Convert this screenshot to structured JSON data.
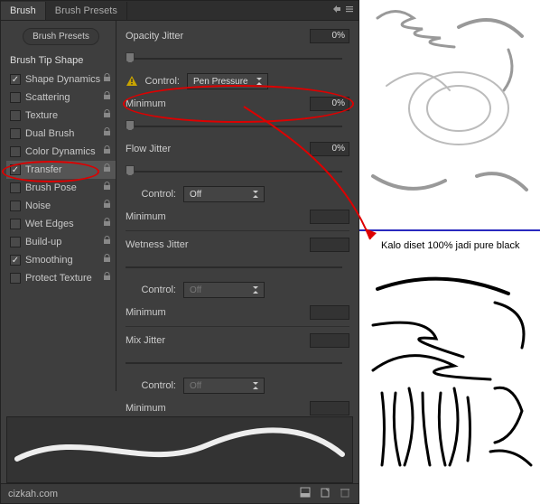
{
  "tabs": {
    "brush": "Brush",
    "presets": "Brush Presets"
  },
  "sidebar": {
    "presets_button": "Brush Presets",
    "tip_shape": "Brush Tip Shape",
    "items": [
      {
        "label": "Shape Dynamics",
        "checked": true,
        "locked": true
      },
      {
        "label": "Scattering",
        "checked": false,
        "locked": true
      },
      {
        "label": "Texture",
        "checked": false,
        "locked": true
      },
      {
        "label": "Dual Brush",
        "checked": false,
        "locked": true
      },
      {
        "label": "Color Dynamics",
        "checked": false,
        "locked": true
      },
      {
        "label": "Transfer",
        "checked": true,
        "locked": true,
        "selected": true
      },
      {
        "label": "Brush Pose",
        "checked": false,
        "locked": true
      },
      {
        "label": "Noise",
        "checked": false,
        "locked": true
      },
      {
        "label": "Wet Edges",
        "checked": false,
        "locked": true
      },
      {
        "label": "Build-up",
        "checked": false,
        "locked": true
      },
      {
        "label": "Smoothing",
        "checked": true,
        "locked": true
      },
      {
        "label": "Protect Texture",
        "checked": false,
        "locked": true
      }
    ]
  },
  "main": {
    "opacity_jitter": {
      "label": "Opacity Jitter",
      "value": "0%"
    },
    "control_label": "Control:",
    "opacity_control": "Pen Pressure",
    "minimum_label": "Minimum",
    "minimum_value": "0%",
    "flow_jitter": {
      "label": "Flow Jitter",
      "value": "0%"
    },
    "flow_control": "Off",
    "min2_label": "Minimum",
    "wetness_label": "Wetness Jitter",
    "wet_control": "Off",
    "min3_label": "Minimum",
    "mix_label": "Mix Jitter",
    "mix_control": "Off",
    "min4_label": "Minimum"
  },
  "watermark": "cizkah.com",
  "annotation": "Kalo diset 100% jadi pure black"
}
